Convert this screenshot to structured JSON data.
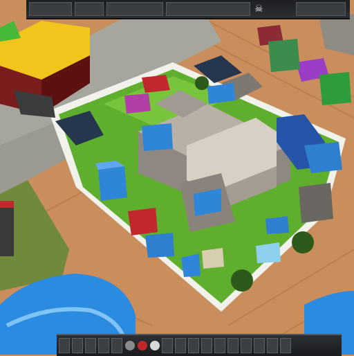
{
  "colors": {
    "dirt": "#c98e5c",
    "dirt_dark": "#b57a48",
    "grass": "#5fae2e",
    "grass_light": "#78c43a",
    "path": "#a8a8a0",
    "stone": "#9c948c",
    "stone_light": "#d8cfc4",
    "water": "#2b8be0",
    "border": "#f4f4f0"
  },
  "icons": {
    "top_right": "skull-icon",
    "bottom_left": "gear-icon",
    "bottom_center": "shield-icon",
    "bottom_right": "coin-icon"
  }
}
